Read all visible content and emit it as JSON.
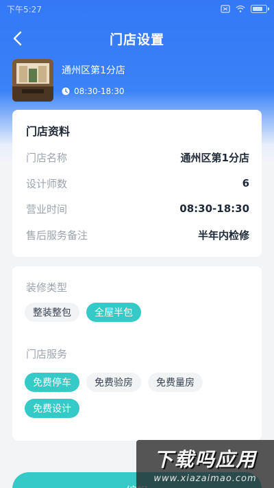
{
  "status_bar": {
    "time": "下午5:27"
  },
  "header": {
    "title": "门店设置"
  },
  "store": {
    "name": "通州区第1分店",
    "hours": "08:30-18:30"
  },
  "info_card": {
    "title": "门店资料",
    "rows": [
      {
        "label": "门店名称",
        "value": "通州区第1分店"
      },
      {
        "label": "设计师数",
        "value": "6"
      },
      {
        "label": "营业时间",
        "value": "08:30-18:30"
      },
      {
        "label": "售后服务备注",
        "value": "半年内检修"
      }
    ]
  },
  "decor_type": {
    "label": "装修类型",
    "chips": [
      {
        "label": "整装整包",
        "active": false
      },
      {
        "label": "全屋半包",
        "active": true
      }
    ]
  },
  "store_services": {
    "label": "门店服务",
    "chips": [
      {
        "label": "免费停车",
        "active": true
      },
      {
        "label": "免费验房",
        "active": false
      },
      {
        "label": "免费量房",
        "active": false
      },
      {
        "label": "免费设计",
        "active": true
      }
    ]
  },
  "actions": {
    "edit_label": "编辑"
  },
  "watermark": {
    "main": "下载吗应用",
    "sub": "www.xiazaimao.com"
  },
  "colors": {
    "primary": "#3478f6",
    "accent": "#35c9c7"
  }
}
